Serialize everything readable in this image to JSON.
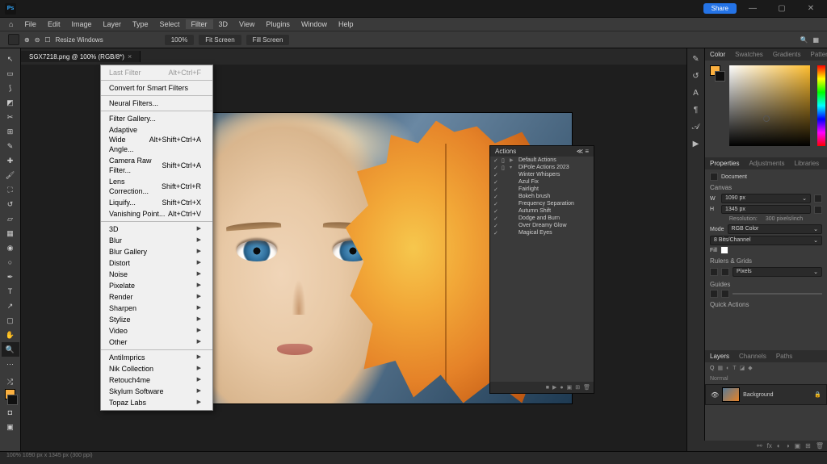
{
  "titlebar": {
    "share": "Share"
  },
  "menu": [
    "File",
    "Edit",
    "Image",
    "Layer",
    "Type",
    "Select",
    "Filter",
    "3D",
    "View",
    "Plugins",
    "Window",
    "Help"
  ],
  "active_menu_index": 6,
  "options": {
    "resize_label": "Resize Windows",
    "z100": "100%",
    "fit": "Fit Screen",
    "fill": "Fill Screen"
  },
  "tab": {
    "label": "SGX7218.png @ 100% (RGB/8*)"
  },
  "filter_menu": {
    "last": {
      "label": "Last Filter",
      "shortcut": "Alt+Ctrl+F"
    },
    "smart": "Convert for Smart Filters",
    "neural": "Neural Filters...",
    "gallery": "Filter Gallery...",
    "wideangle": {
      "label": "Adaptive Wide Angle...",
      "shortcut": "Alt+Shift+Ctrl+A"
    },
    "rawfilter": {
      "label": "Camera Raw Filter...",
      "shortcut": "Shift+Ctrl+A"
    },
    "lens": {
      "label": "Lens Correction...",
      "shortcut": "Shift+Ctrl+R"
    },
    "liquify": {
      "label": "Liquify...",
      "shortcut": "Shift+Ctrl+X"
    },
    "vanish": {
      "label": "Vanishing Point...",
      "shortcut": "Alt+Ctrl+V"
    },
    "groups": [
      "3D",
      "Blur",
      "Blur Gallery",
      "Distort",
      "Noise",
      "Pixelate",
      "Render",
      "Sharpen",
      "Stylize",
      "Video",
      "Other"
    ],
    "plugins": [
      "AntiImprics",
      "Nik Collection",
      "Retouch4me",
      "Skylum Software",
      "Topaz Labs"
    ]
  },
  "actions": {
    "title": "Actions",
    "items": [
      {
        "i": "▶",
        "t": "Default Actions"
      },
      {
        "i": "▾",
        "t": "DiPole Actions 2023"
      },
      {
        "i": "",
        "t": "Winter Whispers"
      },
      {
        "i": "",
        "t": "Azul Fix"
      },
      {
        "i": "",
        "t": "Fairlight"
      },
      {
        "i": "",
        "t": "Bokeh brush"
      },
      {
        "i": "",
        "t": "Frequency Separation"
      },
      {
        "i": "",
        "t": "Autumn Shift"
      },
      {
        "i": "",
        "t": "Dodge and Burn"
      },
      {
        "i": "",
        "t": "Over Dreamy Glow"
      },
      {
        "i": "",
        "t": "Magical Eyes"
      }
    ]
  },
  "color_tabs": [
    "Color",
    "Swatches",
    "Gradients",
    "Patterns"
  ],
  "props_tabs": [
    "Properties",
    "Adjustments",
    "Libraries"
  ],
  "props": {
    "doc": "Document",
    "canvas": "Canvas",
    "w": "1090 px",
    "h": "1345 px",
    "res_label": "Resolution:",
    "res": "300 pixels/inch",
    "mode": "Mode",
    "rgb": "RGB Color",
    "bits": "8 Bits/Channel",
    "fill": "Fill",
    "rulers": "Rulers & Grids",
    "pixels": "Pixels",
    "guides": "Guides",
    "quick": "Quick Actions"
  },
  "layers_tabs": [
    "Layers",
    "Channels",
    "Paths"
  ],
  "layers": {
    "blend": "Normal",
    "bg": "Background",
    "lock": "🔒"
  },
  "status": "100%     1090 px x 1345 px (300 ppi)"
}
